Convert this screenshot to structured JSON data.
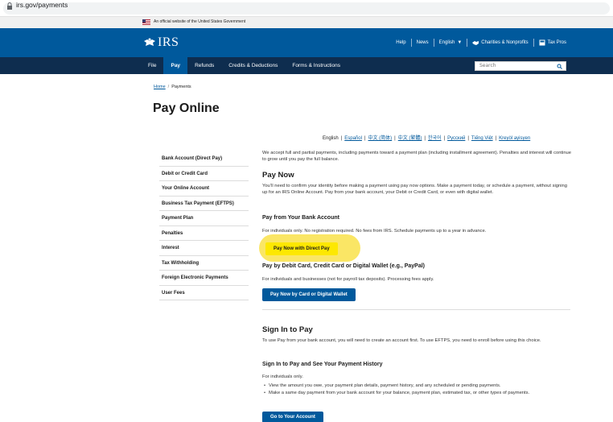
{
  "browser": {
    "url": "irs.gov/payments"
  },
  "gov_banner": {
    "text": "An official website of the United States Government"
  },
  "header": {
    "logo": "IRS",
    "help": "Help",
    "news": "News",
    "language": "English",
    "charities": "Charities & Nonprofits",
    "tax_pros": "Tax Pros"
  },
  "nav": {
    "items": [
      "File",
      "Pay",
      "Refunds",
      "Credits & Deductions",
      "Forms & Instructions"
    ],
    "active": "Pay",
    "search_placeholder": "Search"
  },
  "breadcrumb": {
    "home": "Home",
    "current": "Payments"
  },
  "page_title": "Pay Online",
  "languages": [
    "English",
    "Español",
    "中文 (简体)",
    "中文 (繁體)",
    "한국어",
    "Русский",
    "Tiếng Việt",
    "Kreyòl ayisyen"
  ],
  "sidebar": {
    "items": [
      "Bank Account (Direct Pay)",
      "Debit or Credit Card",
      "Your Online Account",
      "Business Tax Payment (EFTPS)",
      "Payment Plan",
      "Penalties",
      "Interest",
      "Tax Withholding",
      "Foreign Electronic Payments",
      "User Fees"
    ]
  },
  "main": {
    "intro": "We accept full and partial payments, including payments toward a payment plan (including installment agreement). Penalties and interest will continue to grow until you pay the full balance.",
    "pay_now_heading": "Pay Now",
    "pay_now_text": "You’ll need to confirm your identity before making a payment using pay now options. Make a payment today, or schedule a payment, without signing up for an IRS Online Account. Pay from your bank account, your Debit or Credit Card, or even with digital wallet.",
    "bank_heading": "Pay from Your Bank Account",
    "bank_text": "For individuals only. No registration required. No fees from IRS. Schedule payments up to a year in advance.",
    "direct_pay_button": "Pay Now with Direct Pay",
    "card_heading": "Pay by Debit Card, Credit Card or Digital Wallet (e.g., PayPal)",
    "card_text": "For individuals and businesses (not for payroll tax deposits). Processing fees apply.",
    "card_button": "Pay Now by Card or Digital Wallet",
    "signin_heading": "Sign In to Pay",
    "signin_text": "To use Pay from your bank account, you will need to create an account first. To use EFTPS, you need to enroll before using this choice.",
    "signin_sub_heading": "Sign In to Pay and See Your Payment History",
    "signin_sub_text": "For individuals only.",
    "bullets": [
      "View the amount you owe, your payment plan details, payment history, and any scheduled or pending payments.",
      "Make a same day payment from your bank account for your balance, payment plan, estimated tax, or other types of payments."
    ],
    "account_button": "Go to Your Account"
  },
  "colors": {
    "header_blue": "#00599c",
    "nav_dark": "#0e2d4f",
    "highlight_yellow": "#fde801"
  }
}
